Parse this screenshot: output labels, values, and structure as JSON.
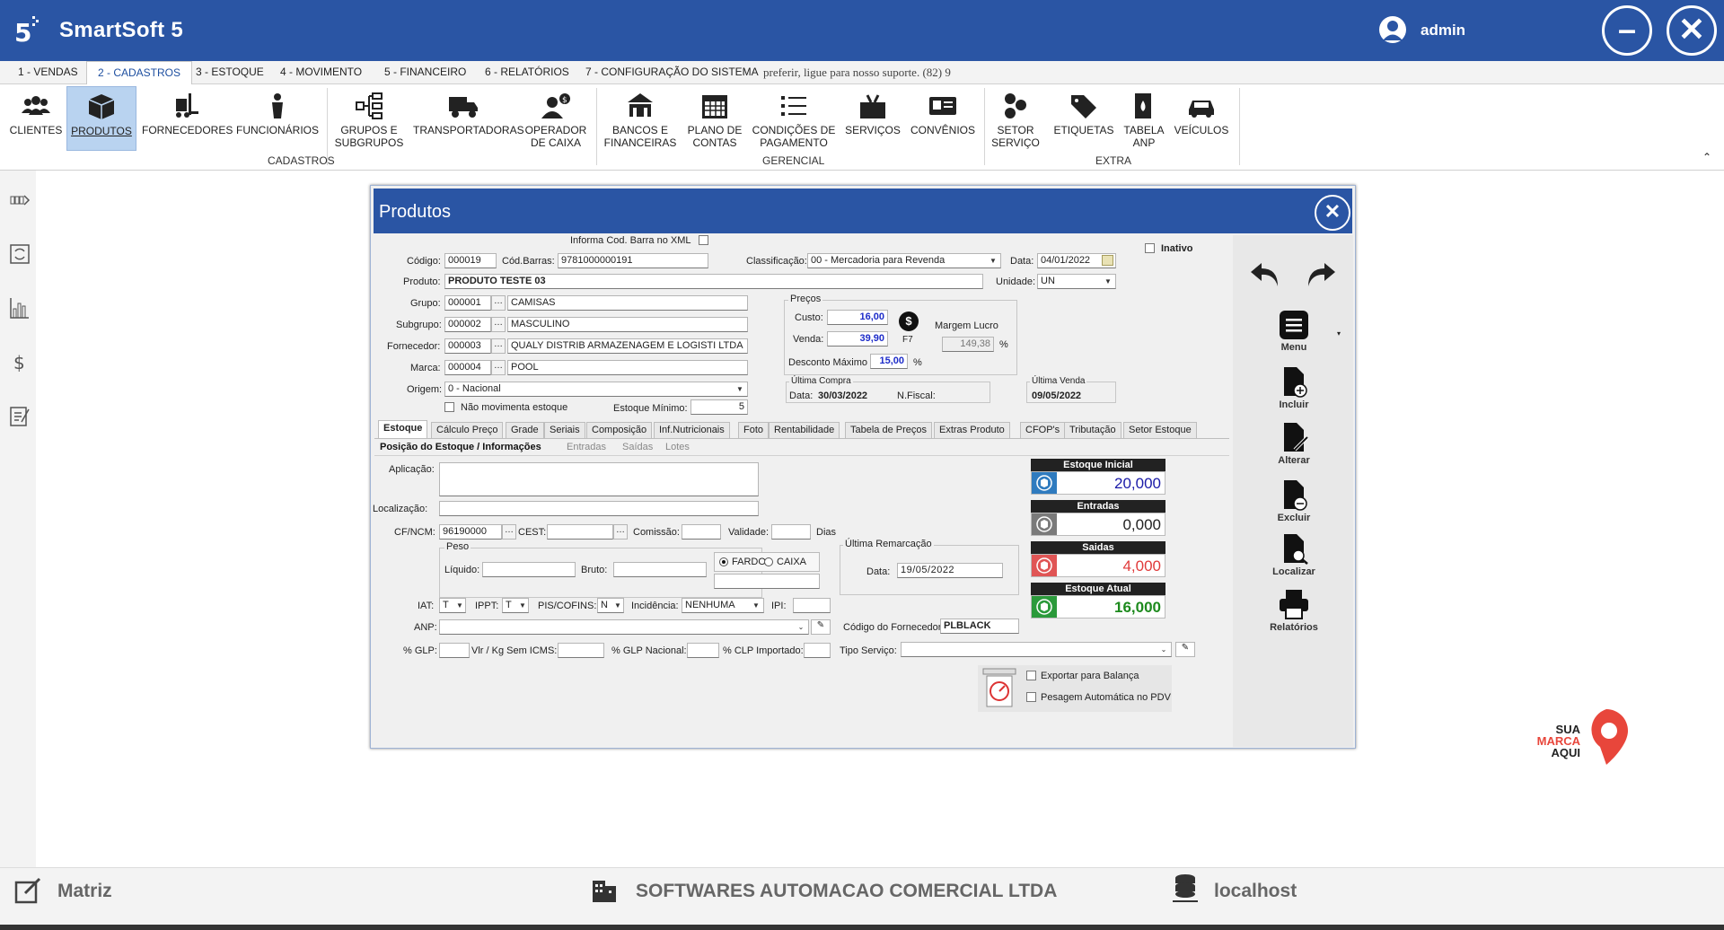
{
  "app": {
    "title": "SmartSoft 5",
    "user": "admin"
  },
  "menu_tabs": [
    "1 - VENDAS",
    "2 - CADASTROS",
    "3 - ESTOQUE",
    "4 - MOVIMENTO",
    "5 - FINANCEIRO",
    "6 - RELATÓRIOS",
    "7 - CONFIGURAÇÃO DO SISTEMA"
  ],
  "menu_notice": "preferir, ligue para nosso suporte. (82) 9",
  "ribbon": {
    "buttons": [
      {
        "l1": "CLIENTES",
        "l2": ""
      },
      {
        "l1": "PRODUTOS",
        "l2": ""
      },
      {
        "l1": "FORNECEDORES",
        "l2": ""
      },
      {
        "l1": "FUNCIONÁRIOS",
        "l2": ""
      },
      {
        "l1": "GRUPOS E",
        "l2": "SUBGRUPOS"
      },
      {
        "l1": "TRANSPORTADORAS",
        "l2": ""
      },
      {
        "l1": "OPERADOR",
        "l2": "DE CAIXA"
      },
      {
        "l1": "BANCOS E",
        "l2": "FINANCEIRAS"
      },
      {
        "l1": "PLANO DE",
        "l2": "CONTAS"
      },
      {
        "l1": "CONDIÇÕES DE",
        "l2": "PAGAMENTO"
      },
      {
        "l1": "SERVIÇOS",
        "l2": ""
      },
      {
        "l1": "CONVÊNIOS",
        "l2": ""
      },
      {
        "l1": "SETOR",
        "l2": "SERVIÇO"
      },
      {
        "l1": "ETIQUETAS",
        "l2": ""
      },
      {
        "l1": "TABELA",
        "l2": "ANP"
      },
      {
        "l1": "VEÍCULOS",
        "l2": ""
      }
    ],
    "groups": [
      "CADASTROS",
      "GERENCIAL",
      "EXTRA"
    ]
  },
  "dialog": {
    "title": "Produtos"
  },
  "form": {
    "informa_cod_barra": "Informa Cod. Barra no XML",
    "inativo": "Inativo",
    "codigo_label": "Código:",
    "codigo": "000019",
    "cod_barras_label": "Cód.Barras:",
    "cod_barras": "9781000000191",
    "classificacao_label": "Classificação:",
    "classificacao": "00 - Mercadoria para Revenda",
    "data_label": "Data:",
    "data": "04/01/2022",
    "produto_label": "Produto:",
    "produto": "PRODUTO TESTE 03",
    "unidade_label": "Unidade:",
    "unidade": "UN",
    "grupo_label": "Grupo:",
    "grupo_cod": "000001",
    "grupo": "CAMISAS",
    "subgrupo_label": "Subgrupo:",
    "subgrupo_cod": "000002",
    "subgrupo": "MASCULINO",
    "fornecedor_label": "Fornecedor:",
    "fornecedor_cod": "000003",
    "fornecedor": "QUALY DISTRIB ARMAZENAGEM E LOGISTI LTDA",
    "marca_label": "Marca:",
    "marca_cod": "000004",
    "marca": "POOL",
    "origem_label": "Origem:",
    "origem": "0 - Nacional",
    "nao_movimenta": "Não movimenta estoque",
    "estoque_minimo_label": "Estoque Mínimo:",
    "estoque_minimo": "5",
    "precos_title": "Preços",
    "custo_label": "Custo:",
    "custo": "16,00",
    "venda_label": "Venda:",
    "venda": "39,90",
    "f7": "F7",
    "margem_label": "Margem Lucro",
    "margem": "149,38",
    "pct": "%",
    "desconto_label": "Desconto Máximo",
    "desconto": "15,00",
    "ultima_compra_title": "Última Compra",
    "uc_data_label": "Data:",
    "uc_data": "30/03/2022",
    "nfiscal_label": "N.Fiscal:",
    "ultima_venda_title": "Última Venda",
    "ultima_venda": "09/05/2022"
  },
  "tabs": [
    "Estoque",
    "Cálculo Preço",
    "Grade",
    "Seriais",
    "Composição",
    "Inf.Nutricionais",
    "Foto",
    "Rentabilidade",
    "Tabela de Preços",
    "Extras Produto",
    "CFOP's",
    "Tributação",
    "Setor Estoque"
  ],
  "subtabs": [
    "Posição do Estoque / Informações",
    "Entradas",
    "Saídas",
    "Lotes"
  ],
  "estoque": {
    "aplicacao_label": "Aplicação:",
    "localizacao_label": "Localização:",
    "cfncm_label": "CF/NCM:",
    "cfncm": "96190000",
    "cest_label": "CEST:",
    "comissao_label": "Comissão:",
    "validade_label": "Validade:",
    "dias": "Dias",
    "peso_title": "Peso",
    "liquido_label": "Líquido:",
    "bruto_label": "Bruto:",
    "fardo": "FARDO",
    "caixa": "CAIXA",
    "remarc_title": "Última Remarcação",
    "remarc_data_label": "Data:",
    "remarc_data": "19/05/2022",
    "iat_label": "IAT:",
    "iat": "T",
    "ippt_label": "IPPT:",
    "ippt": "T",
    "pis_label": "PIS/COFINS:",
    "pis": "N",
    "incid_label": "Incidência:",
    "incid": "NENHUMA",
    "ipi_label": "IPI:",
    "anp_label": "ANP:",
    "codforn_label": "Código do Fornecedor:",
    "codforn": "PLBLACK",
    "glp_label": "% GLP:",
    "vlrkg_label": "Vlr / Kg Sem ICMS:",
    "glpnac_label": "% GLP Nacional:",
    "clpimp_label": "% CLP Importado:",
    "tiposerv_label": "Tipo Serviço:",
    "exportar": "Exportar para Balança",
    "pesagem": "Pesagem Automática no PDV"
  },
  "stock": [
    {
      "title": "Estoque Inicial",
      "value": "20,000",
      "color": "#1a1aa8",
      "icon_color": "#2f7bbf"
    },
    {
      "title": "Entradas",
      "value": "0,000",
      "color": "#222222",
      "icon_color": "#7a7a7a"
    },
    {
      "title": "Saidas",
      "value": "4,000",
      "color": "#e03a3a",
      "icon_color": "#e05555"
    },
    {
      "title": "Estoque Atual",
      "value": "16,000",
      "color": "#1d8a1d",
      "icon_color": "#2b9a3b"
    }
  ],
  "actions": [
    "Menu",
    "Incluir",
    "Alterar",
    "Excluir",
    "Localizar",
    "Relatórios"
  ],
  "brand": {
    "l1": "SUA",
    "l2": "MARCA",
    "l3": "AQUI"
  },
  "status": {
    "filial": "Matriz",
    "empresa": "SOFTWARES AUTOMACAO COMERCIAL LTDA",
    "servidor": "localhost"
  }
}
